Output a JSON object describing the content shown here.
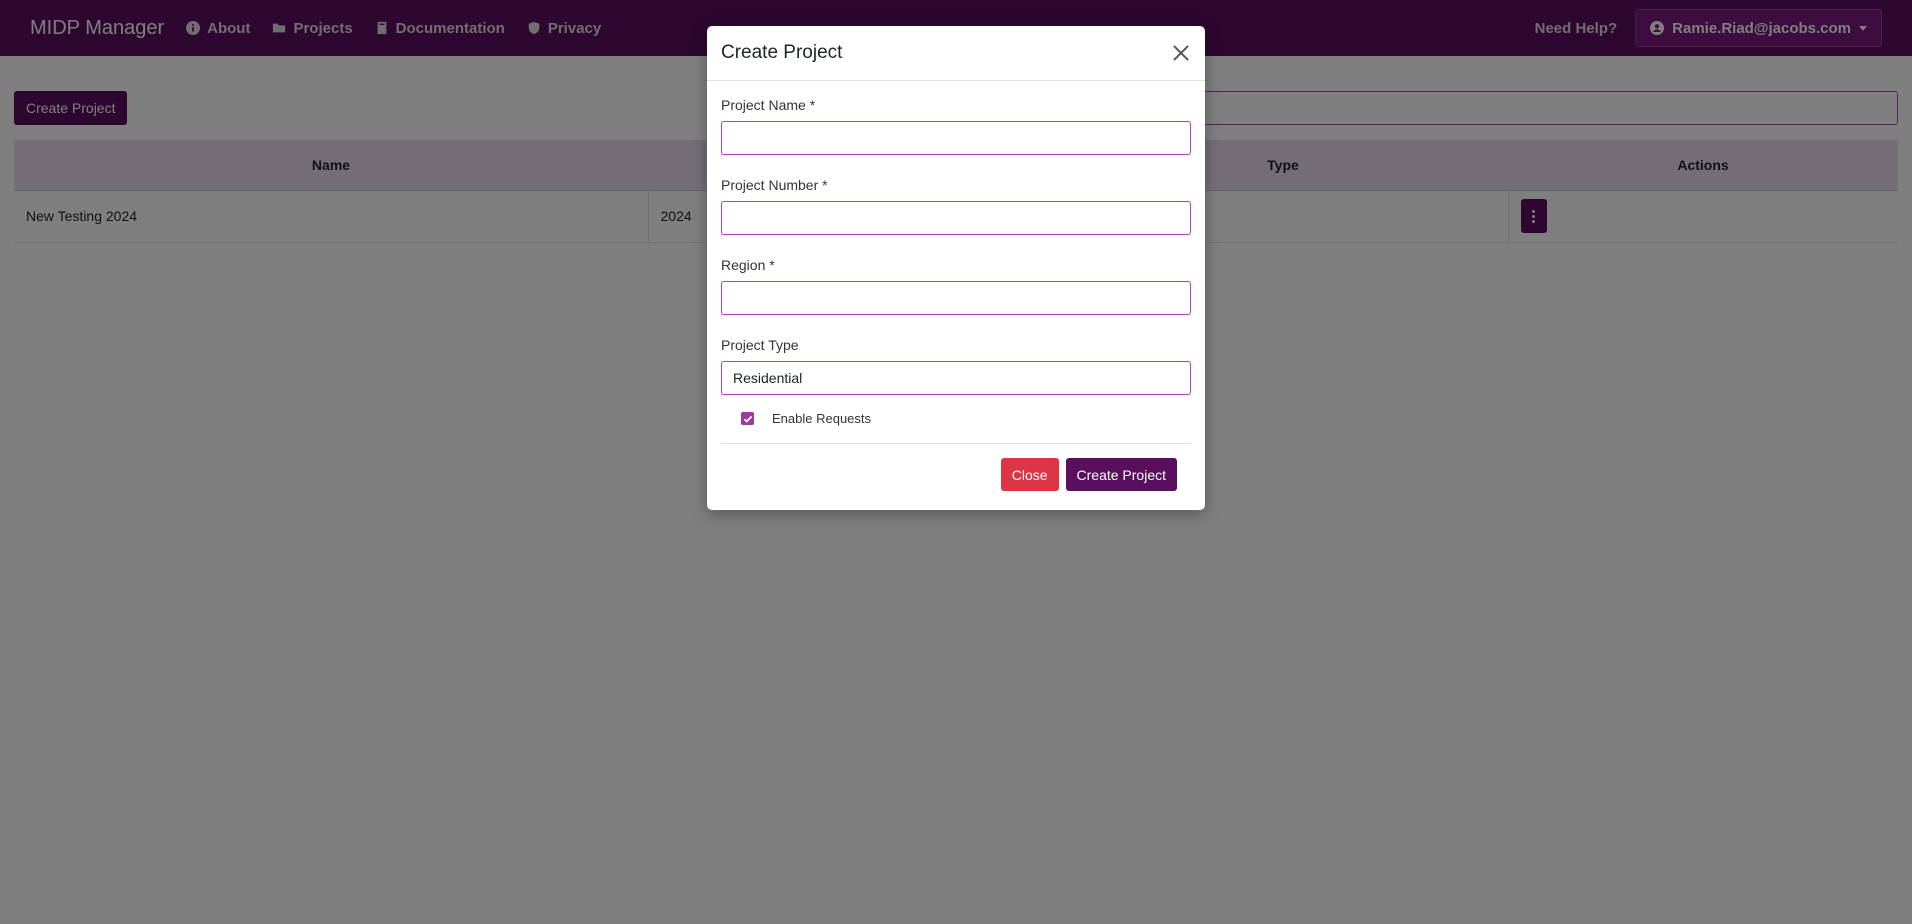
{
  "navbar": {
    "brand": "MIDP Manager",
    "links": [
      "About",
      "Projects",
      "Documentation",
      "Privacy"
    ],
    "help": "Need Help?",
    "user": "Ramie.Riad@jacobs.com"
  },
  "page": {
    "create_button": "Create Project",
    "table": {
      "headers": {
        "name": "Name",
        "type": "Type",
        "actions": "Actions"
      },
      "rows": [
        {
          "name": "New Testing 2024",
          "number": "2024"
        }
      ]
    }
  },
  "modal": {
    "title": "Create Project",
    "fields": {
      "project_name_label": "Project Name *",
      "project_number_label": "Project Number *",
      "region_label": "Region *",
      "project_type_label": "Project Type",
      "project_type_value": "Residential"
    },
    "checkbox_label": "Enable Requests",
    "close_button": "Close",
    "create_button": "Create Project"
  },
  "colors": {
    "primary": "#5a0e5e",
    "danger": "#dc3545",
    "accent": "#9b3aa0"
  }
}
